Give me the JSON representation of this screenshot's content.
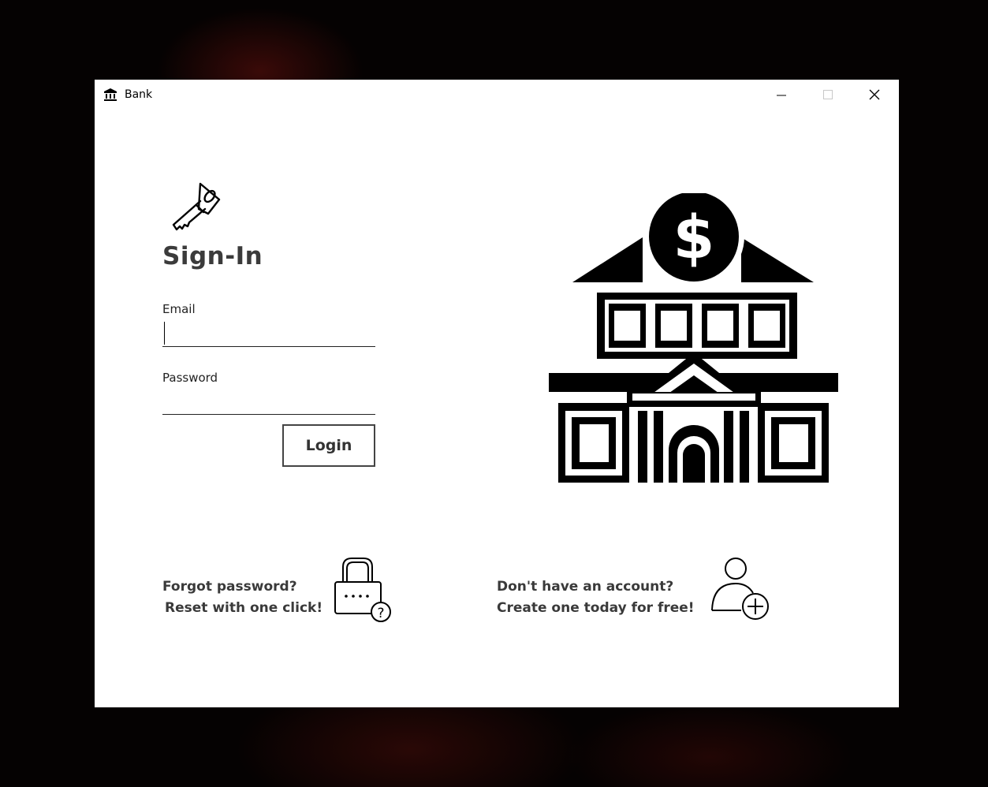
{
  "window": {
    "title": "Bank",
    "app_icon": "bank-icon",
    "controls": [
      "minimize-icon",
      "maximize-icon",
      "close-icon"
    ]
  },
  "signin": {
    "header_icon": "key-icon",
    "title": "Sign-In",
    "email_label": "Email",
    "email_value": "",
    "password_label": "Password",
    "password_value": "",
    "login_label": "Login"
  },
  "illustration": {
    "icon": "bank-building-icon",
    "symbol": "$"
  },
  "links": {
    "forgot_line1": "Forgot password?",
    "forgot_line2": "Reset with one click!",
    "forgot_icon": "padlock-question-icon",
    "create_line1": "Don't have an account?",
    "create_line2": "Create one today for free!",
    "create_icon": "add-user-icon"
  }
}
